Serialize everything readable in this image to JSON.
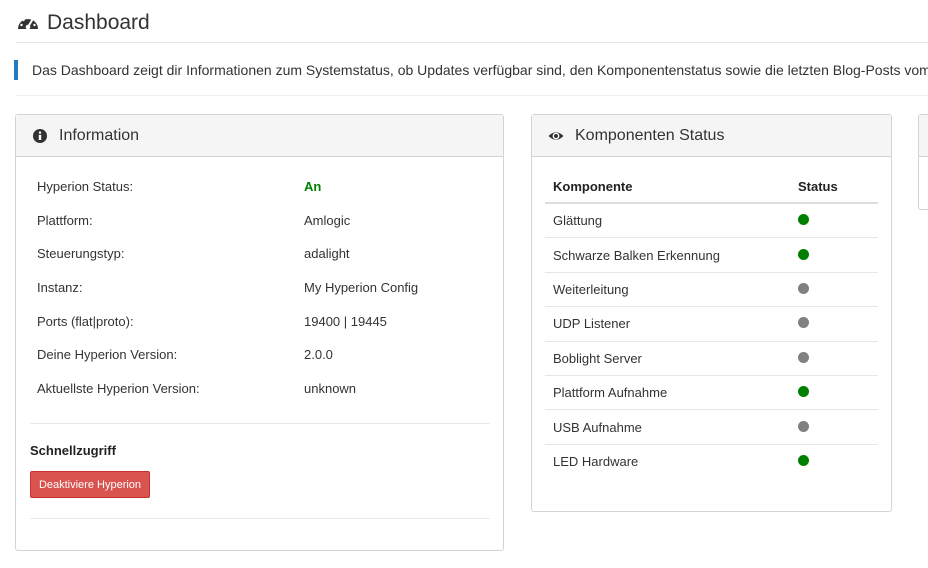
{
  "page": {
    "title": "Dashboard",
    "icon": "dashboard-gauge-icon",
    "intro": "Das Dashboard zeigt dir Informationen zum Systemstatus, ob Updates verfügbar sind, den Komponentenstatus sowie die letzten Blog-Posts vom"
  },
  "information": {
    "title": "Information",
    "icon": "info-circle-icon",
    "rows": [
      {
        "key": "Hyperion Status:",
        "value": "An"
      },
      {
        "key": "Plattform:",
        "value": "Amlogic"
      },
      {
        "key": "Steuerungstyp:",
        "value": "adalight"
      },
      {
        "key": "Instanz:",
        "value": "My Hyperion Config"
      },
      {
        "key": "Ports (flat|proto):",
        "value": "19400 | 19445"
      },
      {
        "key": "Deine Hyperion Version:",
        "value": "2.0.0"
      },
      {
        "key": "Aktuellste Hyperion Version:",
        "value": "unknown"
      }
    ],
    "quick_title": "Schnellzugriff",
    "quick_button": "Deaktiviere Hyperion"
  },
  "components": {
    "title": "Komponenten Status",
    "icon": "eye-icon",
    "headers": [
      "Komponente",
      "Status"
    ],
    "rows": [
      {
        "name": "Glättung",
        "status": "on"
      },
      {
        "name": "Schwarze Balken Erkennung",
        "status": "on"
      },
      {
        "name": "Weiterleitung",
        "status": "off"
      },
      {
        "name": "UDP Listener",
        "status": "off"
      },
      {
        "name": "Boblight Server",
        "status": "off"
      },
      {
        "name": "Plattform Aufnahme",
        "status": "on"
      },
      {
        "name": "USB Aufnahme",
        "status": "off"
      },
      {
        "name": "LED Hardware",
        "status": "on"
      }
    ]
  },
  "colors": {
    "status_on": "#008000",
    "status_off": "#808080",
    "accent": "#1f7cc4",
    "danger": "#d9534f"
  }
}
